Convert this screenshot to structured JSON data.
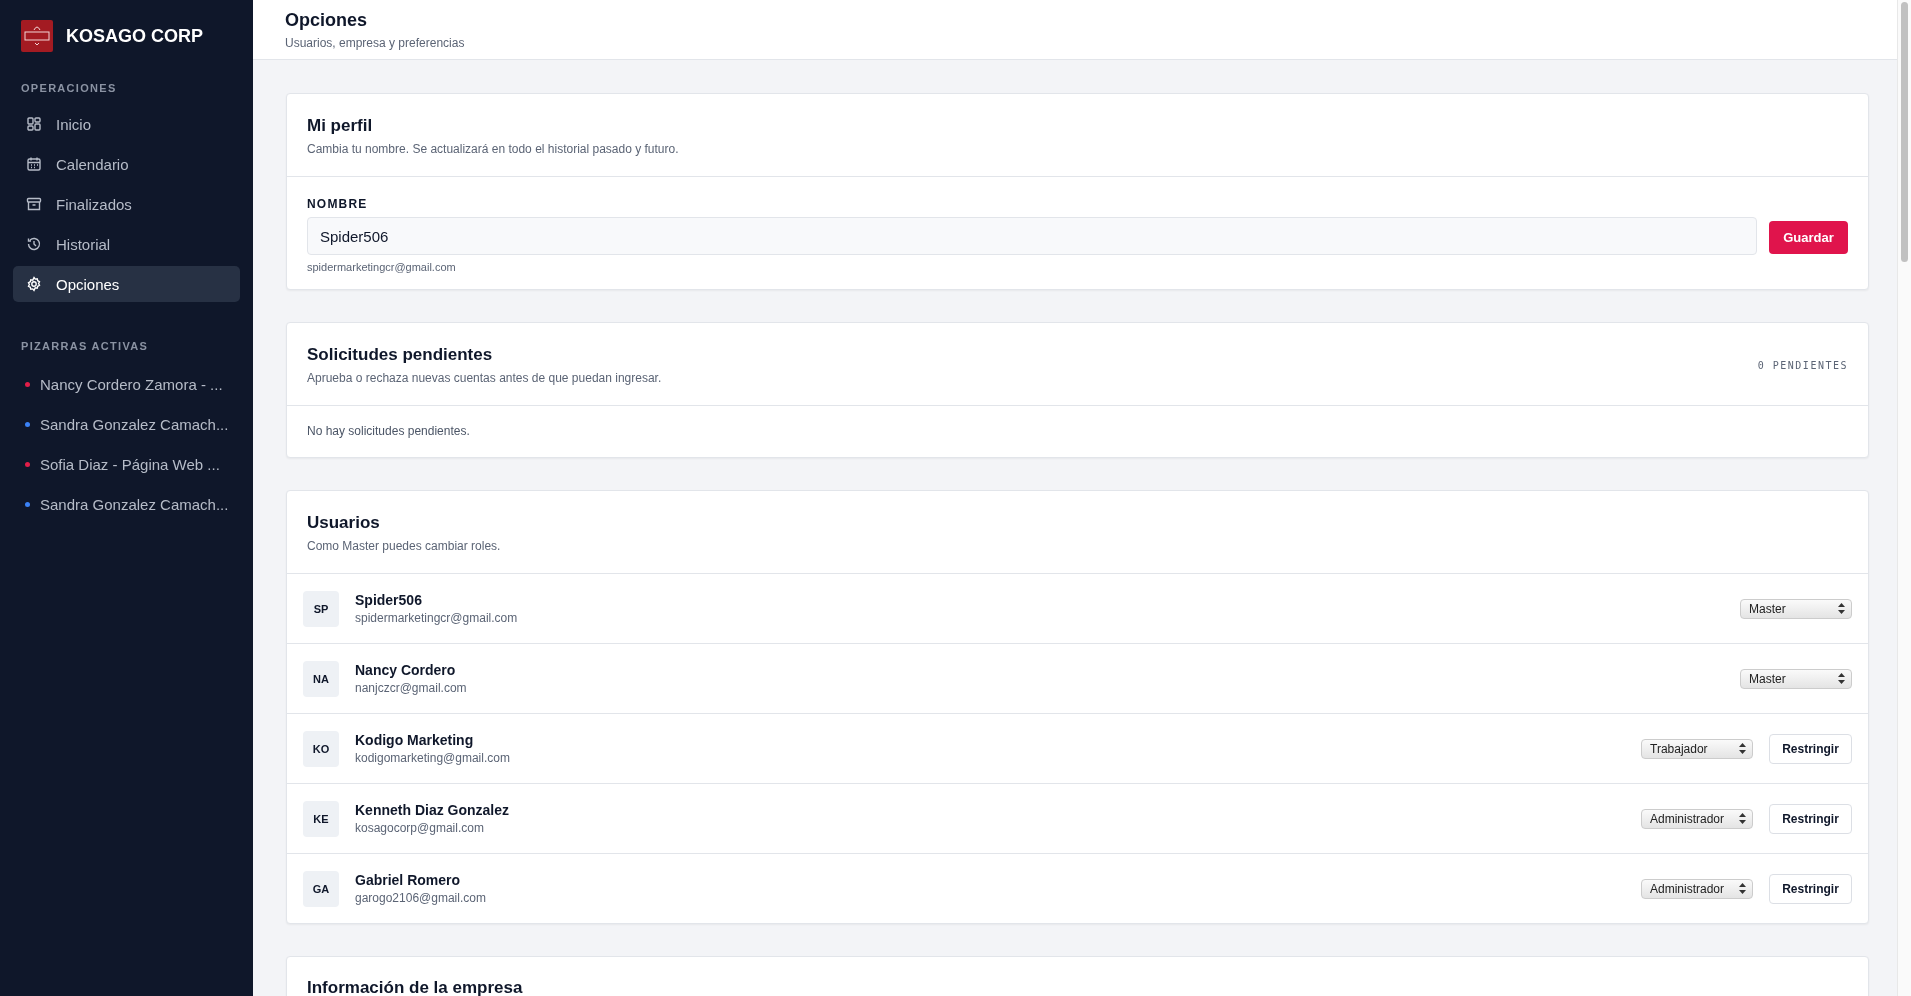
{
  "sidebar": {
    "brand": "KOSAGO CORP",
    "sections": [
      {
        "title": "OPERACIONES",
        "kind": "nav",
        "items": [
          {
            "label": "Inicio",
            "kind": "grid",
            "selected": false
          },
          {
            "label": "Calendario",
            "kind": "calendar",
            "selected": false
          },
          {
            "label": "Finalizados",
            "kind": "archive",
            "selected": false
          },
          {
            "label": "Historial",
            "kind": "history",
            "selected": false
          },
          {
            "label": "Opciones",
            "kind": "gear",
            "selected": true
          }
        ]
      },
      {
        "title": "PIZARRAS ACTIVAS",
        "kind": "boards",
        "items": [
          {
            "label": "Nancy Cordero Zamora - ...",
            "color": "#e11d48"
          },
          {
            "label": "Sandra Gonzalez Camach...",
            "color": "#3b82f6"
          },
          {
            "label": "Sofia Diaz - Página Web ...",
            "color": "#e11d48"
          },
          {
            "label": "Sandra Gonzalez Camach...",
            "color": "#3b82f6"
          }
        ]
      }
    ]
  },
  "header": {
    "title": "Opciones",
    "subtitle": "Usuarios, empresa y preferencias"
  },
  "profile": {
    "title": "Mi perfil",
    "subtitle": "Cambia tu nombre. Se actualizará en todo el historial pasado y futuro.",
    "field_label": "NOMBRE",
    "value": "Spider506",
    "email": "spidermarketingcr@gmail.com",
    "button": "Guardar"
  },
  "requests": {
    "title": "Solicitudes pendientes",
    "subtitle": "Aprueba o rechaza nuevas cuentas antes de que puedan ingresar.",
    "count": "0 PENDIENTES",
    "empty": "No hay solicitudes pendientes."
  },
  "users": {
    "title": "Usuarios",
    "subtitle": "Como Master puedes cambiar roles.",
    "rows": [
      {
        "initials": "SP",
        "name": "Spider506",
        "email": "spidermarketingcr@gmail.com",
        "role": "Master"
      },
      {
        "initials": "NA",
        "name": "Nancy Cordero",
        "email": "nanjczcr@gmail.com",
        "role": "Master"
      },
      {
        "initials": "KO",
        "name": "Kodigo Marketing",
        "email": "kodigomarketing@gmail.com",
        "role": "Trabajador",
        "action": "Restringir"
      },
      {
        "initials": "KE",
        "name": "Kenneth Diaz Gonzalez",
        "email": "kosagocorp@gmail.com",
        "role": "Administrador",
        "action": "Restringir"
      },
      {
        "initials": "GA",
        "name": "Gabriel Romero",
        "email": "garogo2106@gmail.com",
        "role": "Administrador",
        "action": "Restringir"
      }
    ]
  },
  "company": {
    "title": "Información de la empresa"
  }
}
